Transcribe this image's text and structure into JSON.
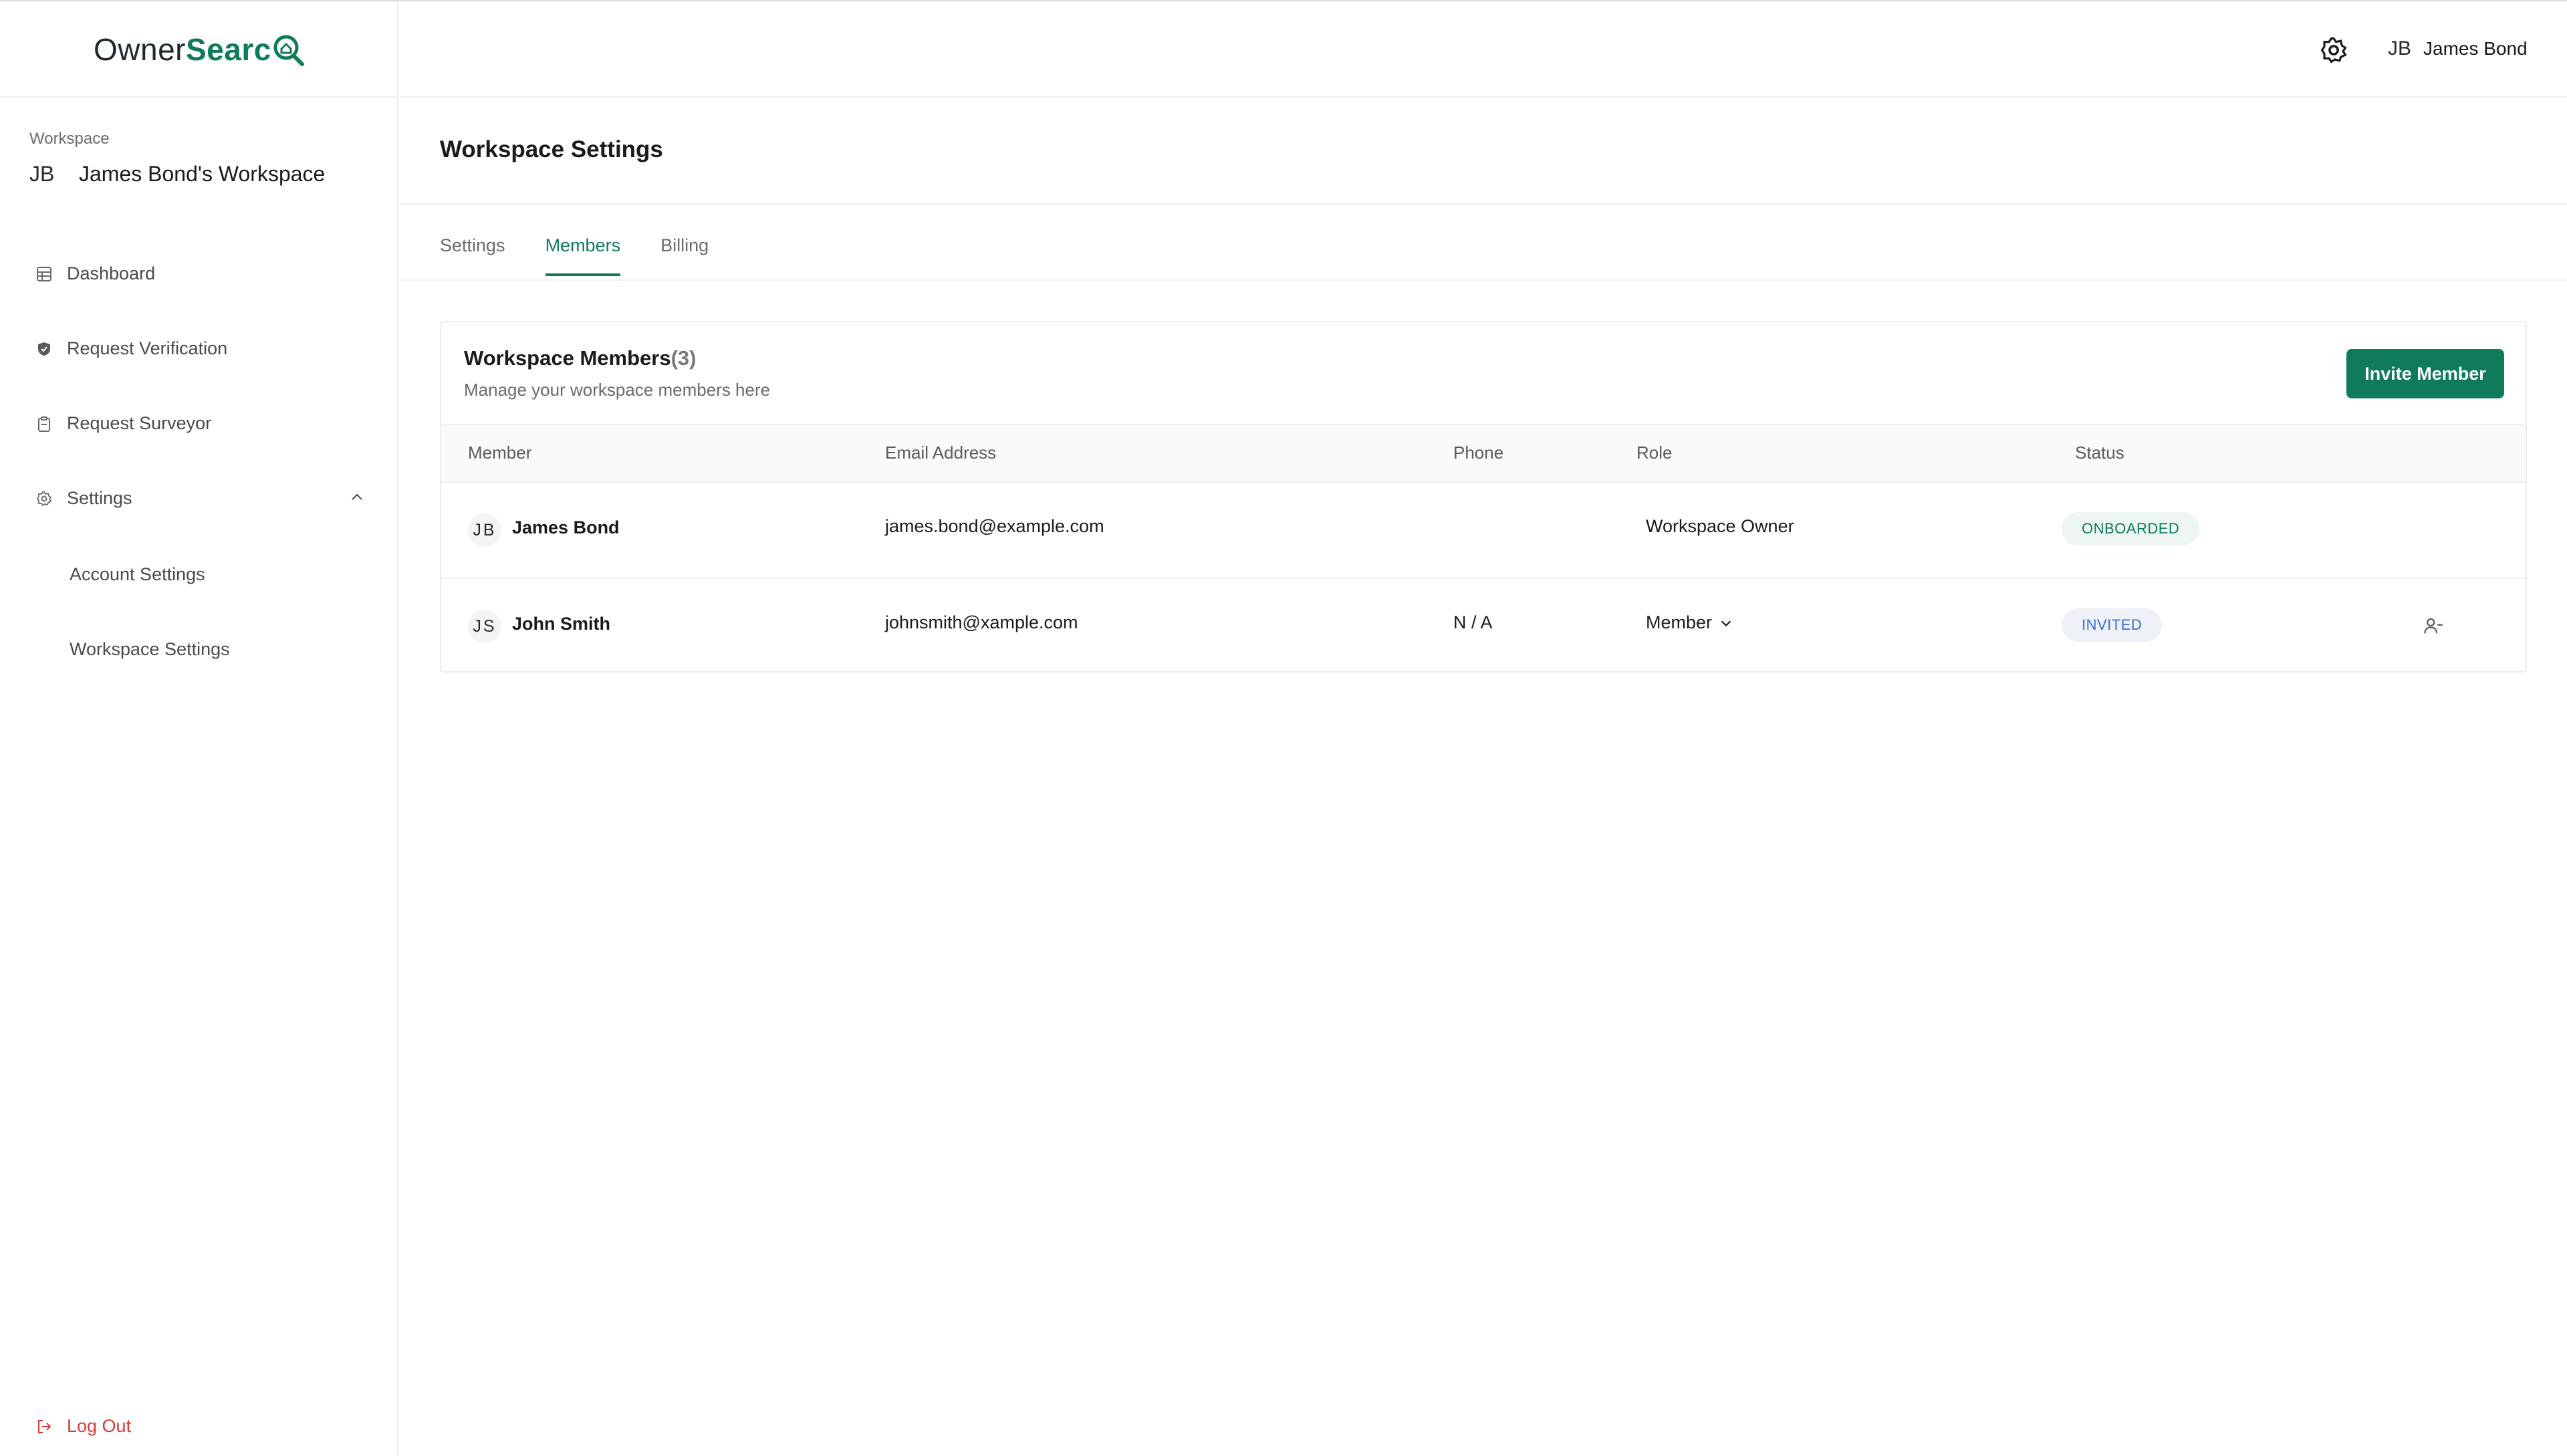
{
  "brand": {
    "logo_part1": "Owner",
    "logo_part2": "Searc"
  },
  "sidebar": {
    "workspace_label": "Workspace",
    "workspace_initials": "JB",
    "workspace_name": "James Bond's Workspace",
    "items": [
      {
        "label": "Dashboard",
        "icon": "grid-icon"
      },
      {
        "label": "Request Verification",
        "icon": "shield-check-icon"
      },
      {
        "label": "Request Surveyor",
        "icon": "clipboard-icon"
      },
      {
        "label": "Settings",
        "icon": "gear-icon",
        "expanded": true
      }
    ],
    "sub_items": [
      {
        "label": "Account Settings"
      },
      {
        "label": "Workspace Settings"
      }
    ],
    "logout_label": "Log Out"
  },
  "header": {
    "user_initials": "JB",
    "user_name": "James Bond"
  },
  "main": {
    "title": "Workspace Settings",
    "tabs": [
      {
        "label": "Settings",
        "active": false
      },
      {
        "label": "Members",
        "active": true
      },
      {
        "label": "Billing",
        "active": false
      }
    ],
    "card": {
      "title": "Workspace Members",
      "count": "(3)",
      "subtitle": "Manage your workspace members here",
      "invite_label": "Invite Member",
      "columns": [
        "Member",
        "Email Address",
        "Phone",
        "Role",
        "Status"
      ],
      "rows": [
        {
          "initials": "JB",
          "name": "James Bond",
          "email": "james.bond@example.com",
          "phone": "",
          "role": "Workspace Owner",
          "status": "ONBOARDED"
        },
        {
          "initials": "JS",
          "name": "John Smith",
          "email": "johnsmith@xample.com",
          "phone": "N / A",
          "role": "Member",
          "status": "INVITED"
        }
      ]
    }
  },
  "colors": {
    "accent": "#0f7a5c",
    "danger": "#d93b3b",
    "invited": "#3b6fd6"
  }
}
